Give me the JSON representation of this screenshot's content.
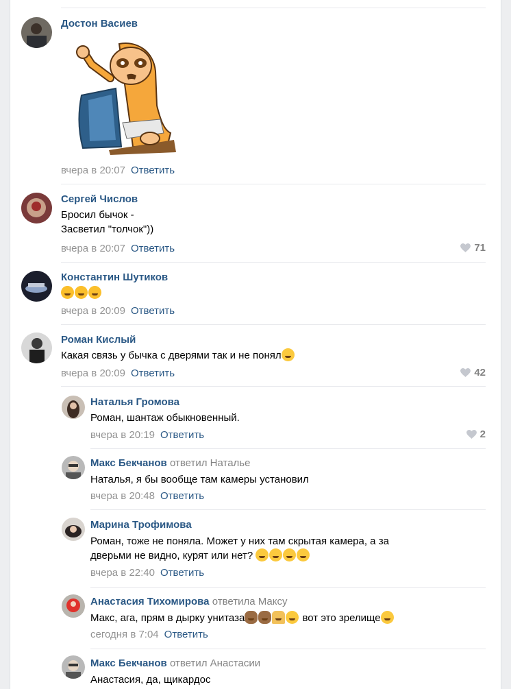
{
  "comments": [
    {
      "author": "Достон Васиев",
      "text": "",
      "sticker": "sticker-sloth",
      "time": "вчера в 20:07",
      "reply": "Ответить",
      "likes": ""
    },
    {
      "author": "Сергей Числов",
      "lines": [
        "Бросил бычок -",
        "Засветил \"толчок\"))"
      ],
      "time": "вчера в 20:07",
      "reply": "Ответить",
      "likes": "71"
    },
    {
      "author": "Константин Шутиков",
      "text": "",
      "emojis": [
        "laugh-emoji",
        "laugh-emoji",
        "laugh-emoji"
      ],
      "time": "вчера в 20:09",
      "reply": "Ответить",
      "likes": ""
    },
    {
      "author": "Роман Кислый",
      "text": "Какая связь у бычка с дверями так и не понял",
      "emojis": [
        "thinking-emoji"
      ],
      "time": "вчера в 20:09",
      "reply": "Ответить",
      "likes": "42"
    },
    {
      "author": "Наталья Громова",
      "text": "Роман, шантаж обыкновенный.",
      "time": "вчера в 20:19",
      "reply": "Ответить",
      "likes": "2"
    },
    {
      "author": "Макс Бекчанов",
      "replied": "ответил",
      "replied_to": "Наталье",
      "text": "Наталья, я бы вообще там камеры установил",
      "time": "вчера в 20:48",
      "reply": "Ответить"
    },
    {
      "author": "Марина Трофимова",
      "lines": [
        "Роман, тоже не поняла. Может у них там скрытая камера, а за",
        "дверьми не видно, курят или нет? "
      ],
      "emojis": [
        "thinking-emoji",
        "thinking-emoji",
        "thinking-emoji",
        "thinking-emoji"
      ],
      "time": "вчера в 22:40",
      "reply": "Ответить"
    },
    {
      "author": "Анастасия Тихомирова",
      "replied": "ответила",
      "replied_to": "Максу",
      "text": "Макс, ага, прям в дырку унитаза",
      "text_after": " вот это зрелище",
      "time": "сегодня в 7:04",
      "reply": "Ответить"
    },
    {
      "author": "Макс Бекчанов",
      "replied": "ответил",
      "replied_to": "Анастасии",
      "text": "Анастасия, да, щикардос"
    }
  ],
  "colors": {
    "link": "#2a5885",
    "meta": "#939393",
    "bg": "#edeef0"
  }
}
